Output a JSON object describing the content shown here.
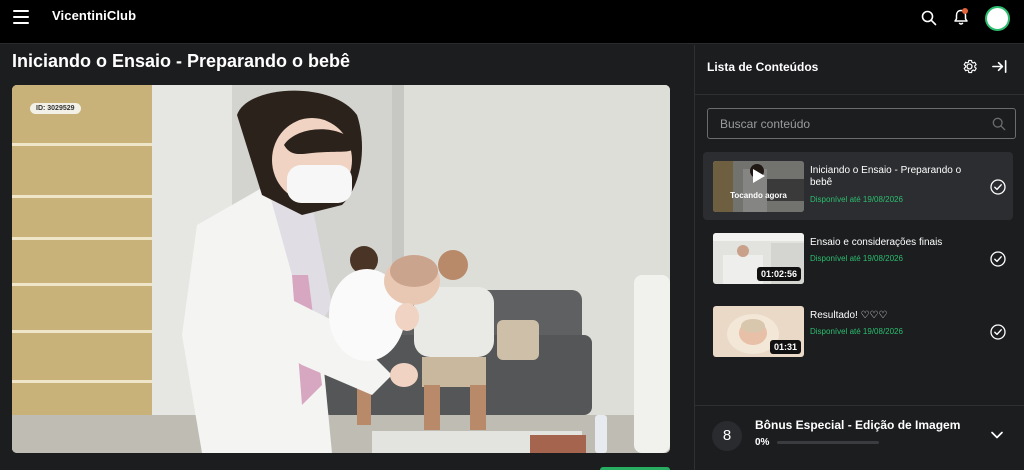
{
  "app": {
    "brand": "VicentiniClub"
  },
  "lesson": {
    "title": "Iniciando o Ensaio - Preparando o bebê",
    "video_id": "ID: 3029529"
  },
  "panel": {
    "title": "Lista de Conteúdos",
    "search_placeholder": "Buscar conteúdo",
    "items": [
      {
        "title": "Iniciando o Ensaio - Preparando o bebê",
        "available": "Disponível até 19/08/2026",
        "badge": "Tocando agora",
        "state": "playing"
      },
      {
        "title": "Ensaio e considerações finais",
        "available": "Disponível até 19/08/2026",
        "duration": "01:02:56"
      },
      {
        "title": "Resultado! ♡♡♡",
        "available": "Disponível até 19/08/2026",
        "duration": "01:31"
      }
    ],
    "bonus": {
      "number": "8",
      "title": "Bônus Especial - Edição de Imagem",
      "progress_label": "0%",
      "progress": 0
    }
  },
  "icons": {
    "menu": "hamburger-icon",
    "search": "search-icon",
    "bell": "bell-icon",
    "avatar": "avatar",
    "settings": "gear-icon",
    "close_panel": "exit-icon",
    "check": "check-circle-icon",
    "expand": "chevron-down-icon",
    "play": "play-icon"
  },
  "colors": {
    "accent": "#2bbd6e",
    "topbar": "#000000",
    "background": "#1c1d1f",
    "notification": "#e2643b"
  }
}
